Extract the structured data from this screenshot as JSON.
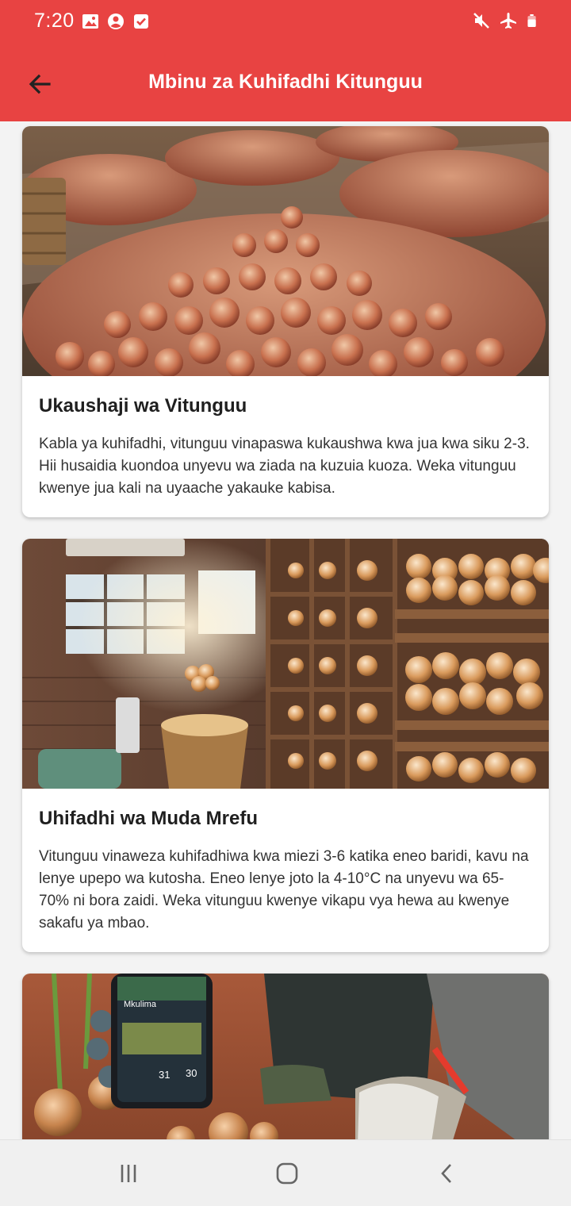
{
  "status_bar": {
    "time": "7:20",
    "left_icons": [
      "image-icon",
      "account-circle-icon",
      "checkbox-icon"
    ],
    "right_icons": [
      "mute-icon",
      "airplane-icon",
      "battery-icon"
    ]
  },
  "app_bar": {
    "title": "Mbinu za Kuhifadhi Kitunguu",
    "back_icon": "arrow-left-icon",
    "background_color": "#e84342"
  },
  "cards": [
    {
      "title": "Ukaushaji wa Vitunguu",
      "text": "Kabla ya kuhifadhi, vitunguu vinapaswa kukaushwa kwa jua kwa siku 2-3. Hii husaidia kuondoa unyevu wa ziada na kuzuia kuoza. Weka vitunguu kwenye jua kali na uyaache yakauke kabisa."
    },
    {
      "title": "Uhifadhi wa Muda Mrefu",
      "text": "Vitunguu vinaweza kuhifadhiwa kwa miezi 3-6 katika eneo baridi, kavu na lenye upepo wa kutosha. Eneo lenye joto la 4-10°C na unyevu wa 65-70% ni bora zaidi. Weka vitunguu kwenye vikapu vya hewa au kwenye sakafu ya mbao."
    },
    {
      "image_text": {
        "app_name": "Mkulima",
        "stat_1": "31",
        "stat_2": "30"
      }
    }
  ],
  "nav_bar": {
    "icons": [
      "recent-apps-icon",
      "home-icon",
      "back-icon"
    ]
  }
}
